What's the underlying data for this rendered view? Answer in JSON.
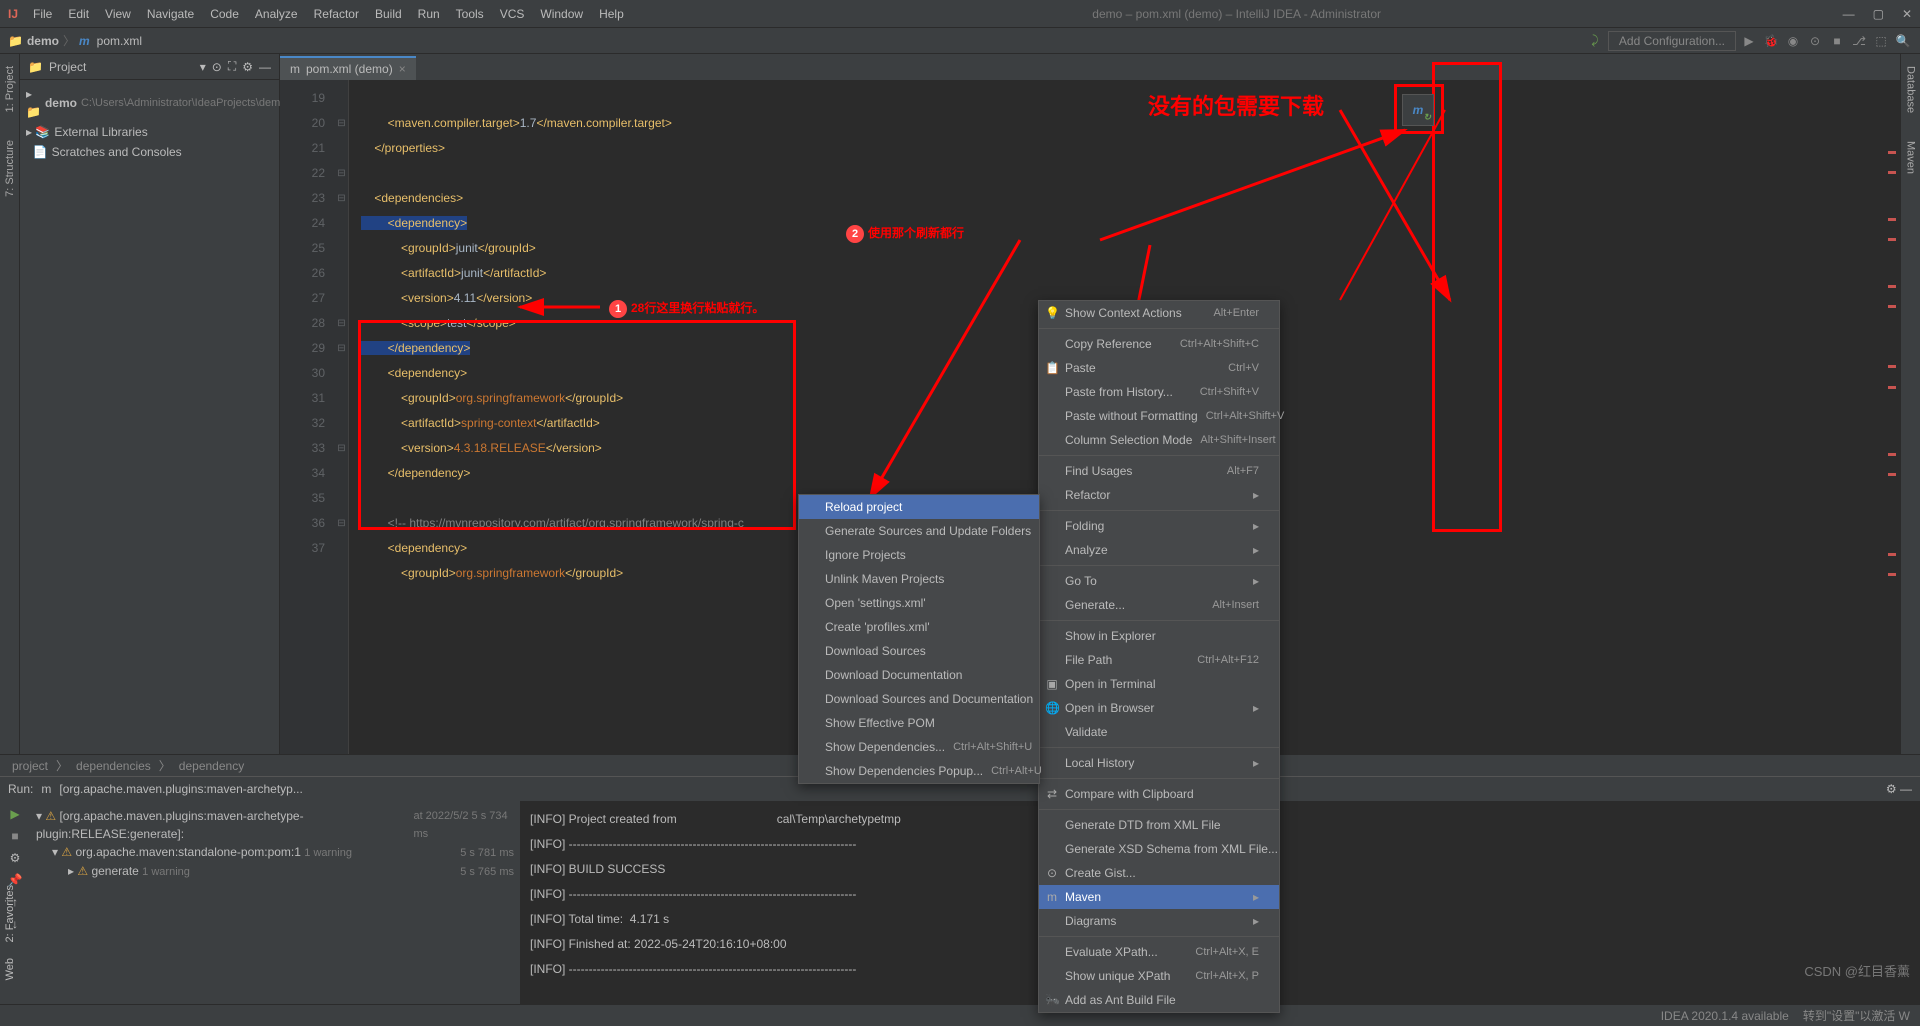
{
  "window": {
    "title": "demo – pom.xml (demo) – IntelliJ IDEA - Administrator"
  },
  "menu": [
    "File",
    "Edit",
    "View",
    "Navigate",
    "Code",
    "Analyze",
    "Refactor",
    "Build",
    "Run",
    "Tools",
    "VCS",
    "Window",
    "Help"
  ],
  "nav": {
    "crumb1": "demo",
    "crumb2": "pom.xml",
    "addcfg": "Add Configuration..."
  },
  "leftTabs": [
    "1: Project",
    "7: Structure"
  ],
  "rightTabs": [
    "Database",
    "Maven"
  ],
  "project": {
    "title": "Project",
    "root": "demo",
    "rootPath": "C:\\Users\\Administrator\\IdeaProjects\\demo",
    "ext": "External Libraries",
    "scr": "Scratches and Consoles"
  },
  "tab": {
    "name": "pom.xml (demo)"
  },
  "lines": [
    19,
    20,
    21,
    22,
    23,
    24,
    25,
    26,
    27,
    28,
    29,
    30,
    31,
    32,
    33,
    34,
    35,
    36,
    37
  ],
  "code": {
    "l19": "        <maven.compiler.target>1.7</maven.compiler.target>",
    "l20": "    </properties>",
    "l22": "    <dependencies>",
    "l23": "        <dependency>",
    "l24": "            <groupId>junit</groupId>",
    "l25": "            <artifactId>junit</artifactId>",
    "l26": "            <version>4.11</version>",
    "l27": "            <scope>test</scope>",
    "l28": "        </dependency>",
    "l29": "        <dependency>",
    "l30": "            <groupId>org.springframework</groupId>",
    "l31": "            <artifactId>spring-context</artifactId>",
    "l32": "            <version>4.3.18.RELEASE</version>",
    "l33": "        </dependency>",
    "l35": "        <!-- https://mvnrepository.com/artifact/org.springframework/spring-c",
    "l36": "        <dependency>",
    "l37": "            <groupId>org.springframework</groupId>"
  },
  "crumb": {
    "a": "project",
    "b": "dependencies",
    "c": "dependency"
  },
  "anno": {
    "a1": "28行这里换行粘贴就行。",
    "a2": "使用那个刷新都行",
    "a3": "没有的包需要下载"
  },
  "run": {
    "title": "Run:",
    "tab": "[org.apache.maven.plugins:maven-archetyp...",
    "r1": "[org.apache.maven.plugins:maven-archetype-plugin:RELEASE:generate]:",
    "r1t": "at 2022/5/2 5 s 734 ms",
    "r2": "org.apache.maven:standalone-pom:pom:1",
    "r2w": "1 warning",
    "r2t": "5 s 781 ms",
    "r3": "generate",
    "r3w": "1 warning",
    "r3t": "5 s 765 ms",
    "c1": "[INFO] Project created from                              cal\\Temp\\archetypetmp",
    "c2": "[INFO] ------------------------------------------------------------------------",
    "c3": "[INFO] BUILD SUCCESS",
    "c4": "[INFO] ------------------------------------------------------------------------",
    "c5": "[INFO] Total time:  4.171 s",
    "c6": "[INFO] Finished at: 2022-05-24T20:16:10+08:00",
    "c7": "[INFO] ------------------------------------------------------------------------"
  },
  "leftBotTabs": [
    "2: Favorites",
    "Web"
  ],
  "ctx1": {
    "items": [
      {
        "k": "reload",
        "l": "Reload project",
        "sel": true
      },
      {
        "k": "gensrc",
        "l": "Generate Sources and Update Folders"
      },
      {
        "k": "ignore",
        "l": "Ignore Projects"
      },
      {
        "k": "unlink",
        "l": "Unlink Maven Projects"
      },
      {
        "k": "openset",
        "l": "Open 'settings.xml'"
      },
      {
        "k": "createprof",
        "l": "Create 'profiles.xml'"
      },
      {
        "k": "dlsrc",
        "l": "Download Sources"
      },
      {
        "k": "dldoc",
        "l": "Download Documentation"
      },
      {
        "k": "dlboth",
        "l": "Download Sources and Documentation"
      },
      {
        "k": "showpom",
        "l": "Show Effective POM"
      },
      {
        "k": "showdep",
        "l": "Show Dependencies...",
        "sc": "Ctrl+Alt+Shift+U"
      },
      {
        "k": "showdepp",
        "l": "Show Dependencies Popup...",
        "sc": "Ctrl+Alt+U"
      }
    ]
  },
  "ctx2": {
    "items": [
      {
        "l": "Show Context Actions",
        "sc": "Alt+Enter",
        "ic": "💡"
      },
      {
        "sep": true
      },
      {
        "l": "Copy Reference",
        "sc": "Ctrl+Alt+Shift+C"
      },
      {
        "l": "Paste",
        "sc": "Ctrl+V",
        "ic": "📋"
      },
      {
        "l": "Paste from History...",
        "sc": "Ctrl+Shift+V"
      },
      {
        "l": "Paste without Formatting",
        "sc": "Ctrl+Alt+Shift+V"
      },
      {
        "l": "Column Selection Mode",
        "sc": "Alt+Shift+Insert"
      },
      {
        "sep": true
      },
      {
        "l": "Find Usages",
        "sc": "Alt+F7"
      },
      {
        "l": "Refactor",
        "arr": true
      },
      {
        "sep": true
      },
      {
        "l": "Folding",
        "arr": true
      },
      {
        "l": "Analyze",
        "arr": true
      },
      {
        "sep": true
      },
      {
        "l": "Go To",
        "arr": true
      },
      {
        "l": "Generate...",
        "sc": "Alt+Insert"
      },
      {
        "sep": true
      },
      {
        "l": "Show in Explorer"
      },
      {
        "l": "File Path",
        "sc": "Ctrl+Alt+F12"
      },
      {
        "l": "Open in Terminal",
        "ic": "▣"
      },
      {
        "l": "Open in Browser",
        "arr": true,
        "ic": "🌐"
      },
      {
        "l": "Validate"
      },
      {
        "sep": true
      },
      {
        "l": "Local History",
        "arr": true
      },
      {
        "sep": true
      },
      {
        "l": "Compare with Clipboard",
        "ic": "⇄"
      },
      {
        "sep": true
      },
      {
        "l": "Generate DTD from XML File"
      },
      {
        "l": "Generate XSD Schema from XML File..."
      },
      {
        "l": "Create Gist...",
        "ic": "⊙"
      },
      {
        "l": "Maven",
        "arr": true,
        "sel": true,
        "ic": "m"
      },
      {
        "l": "Diagrams",
        "arr": true
      },
      {
        "sep": true
      },
      {
        "l": "Evaluate XPath...",
        "sc": "Ctrl+Alt+X, E"
      },
      {
        "l": "Show unique XPath",
        "sc": "Ctrl+Alt+X, P"
      },
      {
        "l": "Add as Ant Build File",
        "ic": "🐜"
      }
    ]
  },
  "status": {
    "ide": "IDEA 2020.1.4 available",
    "act": "转到\"设置\"以激活 W",
    "water": "CSDN @红目香薰"
  }
}
